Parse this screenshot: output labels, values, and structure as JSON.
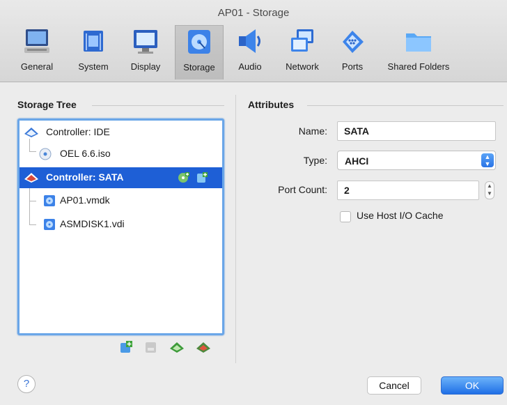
{
  "window": {
    "title": "AP01 - Storage"
  },
  "toolbar": {
    "items": [
      {
        "label": "General",
        "icon": "general-icon"
      },
      {
        "label": "System",
        "icon": "system-icon"
      },
      {
        "label": "Display",
        "icon": "display-icon"
      },
      {
        "label": "Storage",
        "icon": "storage-icon",
        "selected": true
      },
      {
        "label": "Audio",
        "icon": "audio-icon"
      },
      {
        "label": "Network",
        "icon": "network-icon"
      },
      {
        "label": "Ports",
        "icon": "ports-icon"
      },
      {
        "label": "Shared Folders",
        "icon": "shared-folders-icon"
      }
    ]
  },
  "storage_tree": {
    "heading": "Storage Tree",
    "rows": [
      {
        "label": "Controller: IDE",
        "icon": "ide-controller-icon"
      },
      {
        "label": "OEL 6.6.iso",
        "icon": "optical-disk-icon"
      },
      {
        "label": "Controller: SATA",
        "icon": "sata-controller-icon",
        "selected": true
      },
      {
        "label": "AP01.vmdk",
        "icon": "hard-disk-icon"
      },
      {
        "label": "ASMDISK1.vdi",
        "icon": "hard-disk-icon"
      }
    ]
  },
  "attributes": {
    "heading": "Attributes",
    "name_label": "Name:",
    "name_value": "SATA",
    "type_label": "Type:",
    "type_value": "AHCI",
    "port_count_label": "Port Count:",
    "port_count_value": "2",
    "host_cache_label": "Use Host I/O Cache",
    "host_cache_checked": false
  },
  "footer": {
    "help_label": "?",
    "cancel_label": "Cancel",
    "ok_label": "OK"
  },
  "colors": {
    "selection": "#1e5fd6",
    "accent": "#2a74e6"
  }
}
